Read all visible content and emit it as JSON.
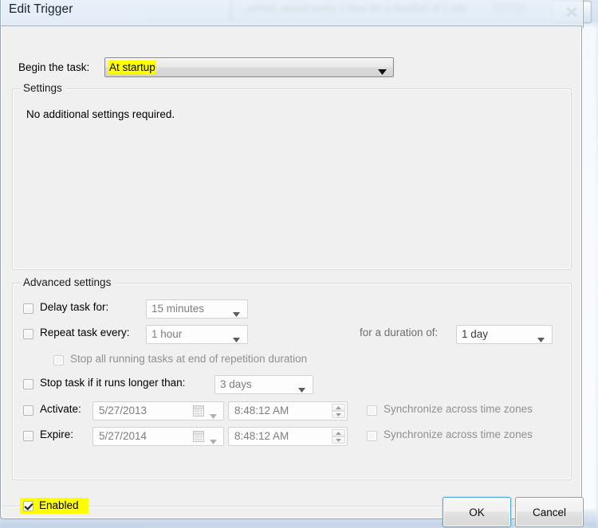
{
  "background": {
    "window_title_text": "...pened, repeat every 1 hour for a duration of 1 day",
    "window_date_text": "5/27/20...",
    "close_icon": "close-icon"
  },
  "dialog": {
    "title": "Edit Trigger",
    "begin_task": {
      "label": "Begin the task:",
      "value": "At startup",
      "highlight_color": "#ffff00",
      "arrow_icon": "chevron-down-icon"
    },
    "settings_group": {
      "title": "Settings",
      "text": "No additional settings required."
    },
    "advanced_group": {
      "title": "Advanced settings",
      "delay_task": {
        "label": "Delay task for:",
        "checked": false,
        "value": "15 minutes"
      },
      "repeat_task": {
        "label": "Repeat task every:",
        "checked": false,
        "value": "1 hour",
        "duration_label": "for a duration of:",
        "duration_value": "1 day"
      },
      "stop_all_running": {
        "label": "Stop all running tasks at end of repetition duration",
        "checked": false,
        "disabled": true
      },
      "stop_task_longer": {
        "label": "Stop task if it runs longer than:",
        "checked": false,
        "value": "3 days"
      },
      "activate": {
        "label": "Activate:",
        "checked": false,
        "date": "5/27/2013",
        "time": "8:48:12 AM",
        "sync_label": "Synchronize across time zones",
        "sync_checked": false
      },
      "expire": {
        "label": "Expire:",
        "checked": false,
        "date": "5/27/2014",
        "time": "8:48:12 AM",
        "sync_label": "Synchronize across time zones",
        "sync_checked": false
      }
    },
    "enabled": {
      "label": "Enabled",
      "checked": true,
      "highlight_color": "#ffff00"
    },
    "buttons": {
      "ok": "OK",
      "cancel": "Cancel"
    }
  }
}
